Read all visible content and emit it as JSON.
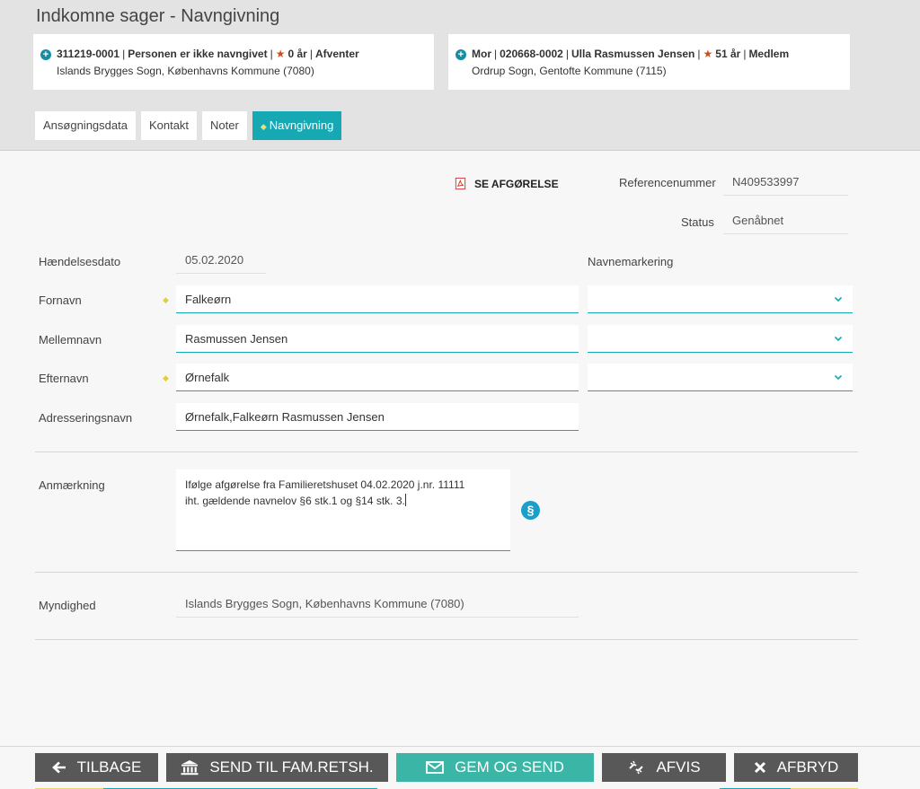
{
  "header": {
    "title": "Indkomne sager - Navngivning",
    "cards": [
      {
        "id": "311219-0001",
        "status_text": "Personen er ikke navngivet",
        "age": "0 år",
        "state": "Afventer",
        "parish": "Islands Brygges Sogn, Københavns Kommune (7080)"
      },
      {
        "role": "Mor",
        "id": "020668-0002",
        "name": "Ulla Rasmussen Jensen",
        "age": "51 år",
        "state": "Medlem",
        "parish": "Ordrup Sogn, Gentofte Kommune (7115)"
      }
    ],
    "tabs": [
      {
        "label": "Ansøgningsdata"
      },
      {
        "label": "Kontakt"
      },
      {
        "label": "Noter"
      },
      {
        "label": "Navngivning"
      }
    ]
  },
  "form": {
    "see_decision_label": "SE AFGØRELSE",
    "reference_label": "Referencenummer",
    "reference_value": "N409533997",
    "status_label": "Status",
    "status_value": "Genåbnet",
    "event_date_label": "Hændelsesdato",
    "event_date_value": "05.02.2020",
    "name_marking_label": "Navnemarkering",
    "first_name_label": "Fornavn",
    "first_name_value": "Falkeørn",
    "middle_name_label": "Mellemnavn",
    "middle_name_value": "Rasmussen Jensen",
    "last_name_label": "Efternavn",
    "last_name_value": "Ørnefalk",
    "addressing_name_label": "Adresseringsnavn",
    "addressing_name_value": "Ørnefalk,Falkeørn Rasmussen Jensen",
    "remark_label": "Anmærkning",
    "remark_line1": "Ifølge afgørelse fra Familieretshuset 04.02.2020 j.nr. 11111",
    "remark_line2": "iht. gældende navnelov §6 stk.1 og §14 stk. 3.",
    "paragraph_symbol": "§",
    "authority_label": "Myndighed",
    "authority_value": "Islands Brygges Sogn, Københavns Kommune (7080)"
  },
  "footer": {
    "back_label": "TILBAGE",
    "send_label": "SEND TIL FAM.RETSH.",
    "save_send_label": "GEM OG SEND",
    "reject_label": "AFVIS",
    "cancel_label": "AFBRYD"
  },
  "colors": {
    "accent_teal": "#16a9b3",
    "primary_button": "#3bb6a6",
    "dark_button": "#585858",
    "required_dot": "#e1cf40",
    "pdf_red": "#d9342b"
  }
}
